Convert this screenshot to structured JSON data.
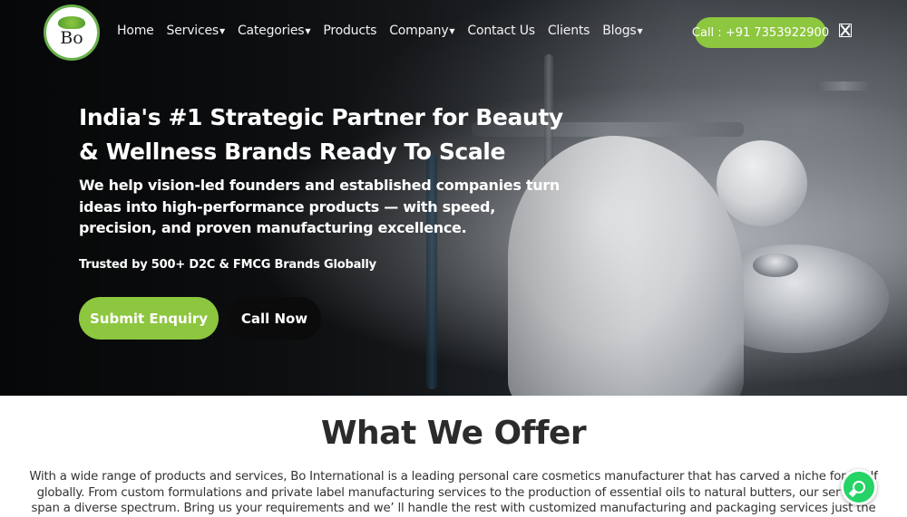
{
  "brand": {
    "logo_text": "Bo",
    "accent": "#8dc63f"
  },
  "nav": {
    "items": [
      {
        "label": "Home",
        "dropdown": false
      },
      {
        "label": "Services",
        "dropdown": true
      },
      {
        "label": "Categories",
        "dropdown": true
      },
      {
        "label": "Products",
        "dropdown": false
      },
      {
        "label": "Company",
        "dropdown": true
      },
      {
        "label": "Contact Us",
        "dropdown": false
      },
      {
        "label": "Clients",
        "dropdown": false
      },
      {
        "label": "Blogs",
        "dropdown": true
      }
    ],
    "call_label": "Call : +91 7353922900",
    "close_icon": "close-icon"
  },
  "hero": {
    "heading": "India's #1 Strategic Partner for Beauty & Wellness Brands Ready To Scale",
    "lead": "We help vision-led founders and established companies turn ideas into high-performance products — with speed, precision, and proven manufacturing excellence.",
    "trusted": "Trusted by 500+ D2C & FMCG Brands Globally",
    "primary_button": "Submit Enquiry",
    "secondary_button": "Call Now"
  },
  "offer": {
    "title": "What We Offer",
    "text": "With a wide range of products and services, Bo International is a leading personal care cosmetics manufacturer that has carved a niche for itself globally. From custom formulations and private label manufacturing services to the production of essential oils to natural butters, our services span a diverse spectrum. Bring us your requirements and we’ ll handle the rest with customized manufacturing and packaging services just the"
  },
  "whatsapp": {
    "icon": "whatsapp-icon",
    "color": "#25d366"
  }
}
